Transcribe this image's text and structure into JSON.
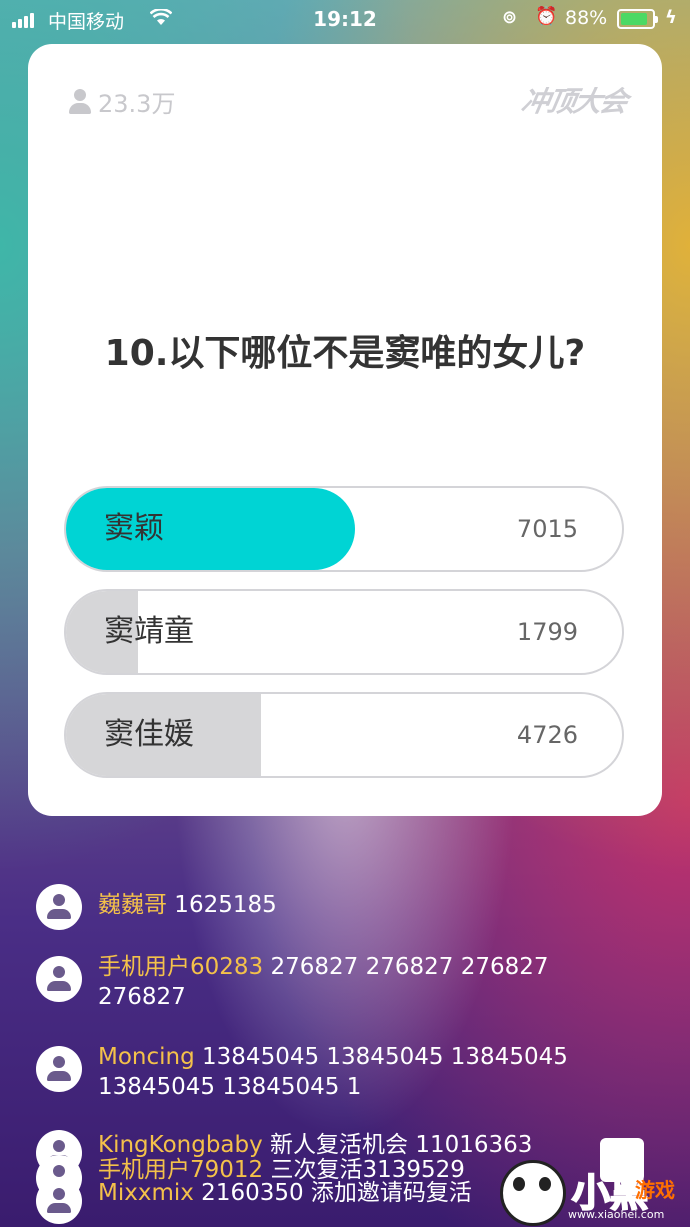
{
  "status_bar": {
    "carrier": "中国移动",
    "time": "19:12",
    "battery_percent": "88%",
    "battery_level": 0.88,
    "accent_battery": "#4cd964"
  },
  "card": {
    "viewer_count": "23.3万",
    "logo_text": "冲顶大会",
    "question": "10.以下哪位不是窦唯的女儿?",
    "options": [
      {
        "label": "窦颖",
        "count": "7015",
        "fraction": 0.52,
        "bar_color": "#00d4d4"
      },
      {
        "label": "窦靖童",
        "count": "1799",
        "fraction": 0.13,
        "bar_color": "#d6d6d8"
      },
      {
        "label": "窦佳媛",
        "count": "4726",
        "fraction": 0.35,
        "bar_color": "#d6d6d8"
      }
    ]
  },
  "comments": [
    {
      "username": "巍巍哥",
      "text": " 1625185"
    },
    {
      "username": "手机用户60283",
      "text": " 276827  276827 276827  276827"
    },
    {
      "username": "Moncing",
      "text": " 13845045  13845045 13845045 13845045  13845045  1"
    },
    {
      "username": "KingKongbaby",
      "text": " 新人复活机会 11016363"
    },
    {
      "username": "手机用户79012",
      "text": " 三次复活3139529"
    },
    {
      "username": "Mixxmix",
      "text": " 2160350  添加邀请码复活"
    }
  ],
  "watermark": {
    "brand": "小黑",
    "brand_sub": "游戏",
    "url": "www.xiaohei.com"
  }
}
